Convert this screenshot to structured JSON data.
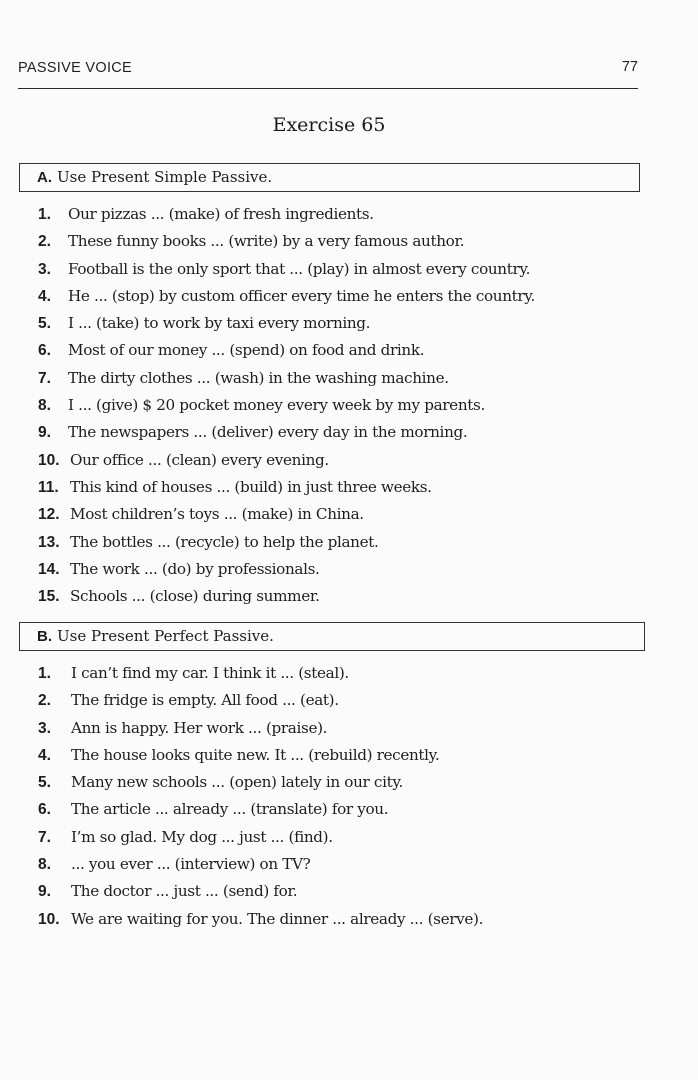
{
  "header": {
    "section": "PASSIVE VOICE",
    "page_number": "77"
  },
  "exercise": {
    "title": "Exercise 65"
  },
  "part_a": {
    "letter": "A.",
    "instruction": "Use Present Simple Passive.",
    "items": [
      {
        "num": "1.",
        "text": "Our pizzas ... (make) of fresh ingredients."
      },
      {
        "num": "2.",
        "text": "These funny books ... (write) by a very famous author."
      },
      {
        "num": "3.",
        "text": "Football is the only sport that ... (play) in almost every country."
      },
      {
        "num": "4.",
        "text": "He ... (stop) by custom officer every time he enters the country."
      },
      {
        "num": "5.",
        "text": "I ... (take) to work by taxi every morning."
      },
      {
        "num": "6.",
        "text": "Most of our money ... (spend) on food and drink."
      },
      {
        "num": "7.",
        "text": "The dirty clothes ... (wash) in the washing machine."
      },
      {
        "num": "8.",
        "text": "I ... (give) $ 20 pocket money every week by my parents."
      },
      {
        "num": "9.",
        "text": "The newspapers ... (deliver) every day in the morning."
      },
      {
        "num": "10.",
        "text": "Our office ... (clean) every evening."
      },
      {
        "num": "11.",
        "text": "This kind of houses ... (build) in just three weeks."
      },
      {
        "num": "12.",
        "text": "Most children’s toys ... (make) in China."
      },
      {
        "num": "13.",
        "text": "The bottles ... (recycle) to help the planet."
      },
      {
        "num": "14.",
        "text": "The work ... (do) by professionals."
      },
      {
        "num": "15.",
        "text": "Schools ... (close) during summer."
      }
    ]
  },
  "part_b": {
    "letter": "B.",
    "instruction": "Use Present Perfect Passive.",
    "items": [
      {
        "num": "1.",
        "text": "I can’t find my car. I think it ... (steal)."
      },
      {
        "num": "2.",
        "text": "The fridge is empty. All food ... (eat)."
      },
      {
        "num": "3.",
        "text": "Ann is happy. Her work ... (praise)."
      },
      {
        "num": "4.",
        "text": "The house looks quite new. It ... (rebuild) recently."
      },
      {
        "num": "5.",
        "text": "Many new schools ... (open) lately in our city."
      },
      {
        "num": "6.",
        "text": "The article ... already ... (translate) for you."
      },
      {
        "num": "7.",
        "text": "I’m so glad. My dog ... just ... (find)."
      },
      {
        "num": "8.",
        "text": "... you ever ... (interview) on TV?"
      },
      {
        "num": "9.",
        "text": "The doctor ... just ... (send) for."
      },
      {
        "num": "10.",
        "text": "We are waiting for you. The dinner ... already ... (serve)."
      }
    ]
  }
}
